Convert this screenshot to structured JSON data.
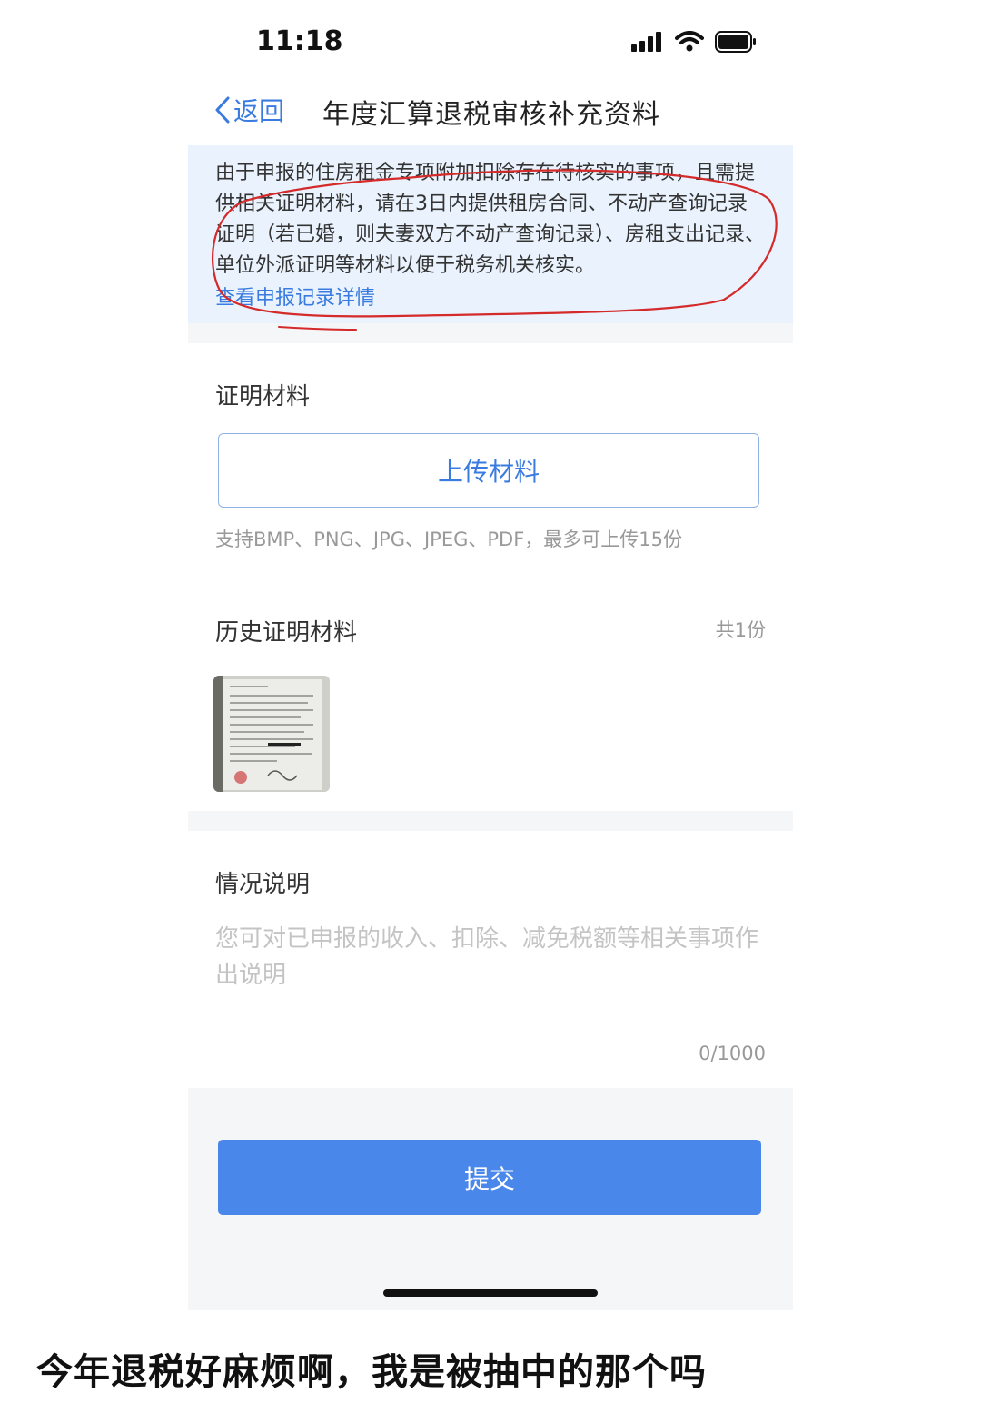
{
  "status_bar": {
    "time": "11:18"
  },
  "nav": {
    "back_label": "返回",
    "title": "年度汇算退税审核补充资料"
  },
  "notice": {
    "text": "由于申报的住房租金专项附加扣除存在待核实的事项，且需提供相关证明材料，请在3日内提供租房合同、不动产查询记录证明（若已婚，则夫妻双方不动产查询记录）、房租支出记录、单位外派证明等材料以便于税务机关核实。",
    "link": "查看申报记录详情"
  },
  "proof": {
    "title": "证明材料",
    "upload_label": "上传材料",
    "hint": "支持BMP、PNG、JPG、JPEG、PDF，最多可上传15份"
  },
  "history": {
    "title": "历史证明材料",
    "count": "共1份"
  },
  "explanation": {
    "title": "情况说明",
    "placeholder": "您可对已申报的收入、扣除、减免税额等相关事项作出说明",
    "counter": "0/1000"
  },
  "submit_label": "提交",
  "caption": "今年退税好麻烦啊，我是被抽中的那个吗",
  "colors": {
    "accent": "#3a7be0",
    "submit": "#4a87ea",
    "notice_bg": "#eaf3fd",
    "annotation": "#d42a2a"
  }
}
